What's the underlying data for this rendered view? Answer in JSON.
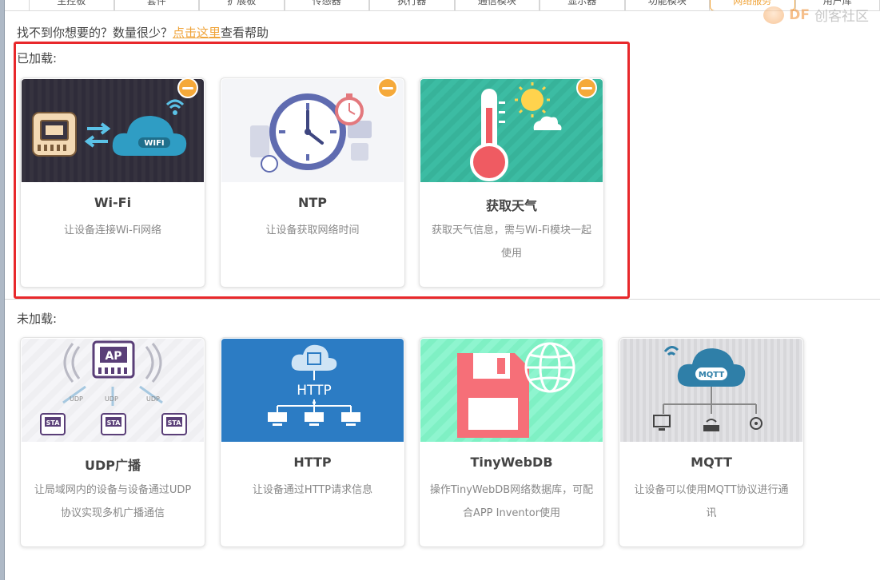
{
  "tabs": [
    "主控板",
    "套件",
    "扩展板",
    "传感器",
    "执行器",
    "通信模块",
    "显示器",
    "功能模块",
    "网络服务",
    "用户库"
  ],
  "active_tab": "网络服务",
  "watermark": {
    "brand": "DF",
    "text": "创客社区"
  },
  "help": {
    "prefix": "找不到你想要的？数量很少？",
    "link": "点击这里",
    "suffix": "查看帮助"
  },
  "loaded": {
    "label": "已加载:",
    "cards": [
      {
        "title": "Wi-Fi",
        "desc": "让设备连接Wi-Fi网络",
        "icon": "wifi-cloud-board-icon"
      },
      {
        "title": "NTP",
        "desc": "让设备获取网络时间",
        "icon": "clock-icon"
      },
      {
        "title": "获取天气",
        "desc": "获取天气信息，需与Wi-Fi模块一起使用",
        "icon": "thermometer-sun-icon"
      }
    ]
  },
  "unloaded": {
    "label": "未加载:",
    "cards": [
      {
        "title": "UDP广播",
        "desc": "让局域网内的设备与设备通过UDP协议实现多机广播通信",
        "icon": "udp-ap-sta-icon",
        "labels": {
          "ap": "AP",
          "sta": "STA",
          "udp": "UDP"
        }
      },
      {
        "title": "HTTP",
        "desc": "让设备通过HTTP请求信息",
        "icon": "http-cloud-icon",
        "labels": {
          "http": "HTTP"
        }
      },
      {
        "title": "TinyWebDB",
        "desc": "操作TinyWebDB网络数据库，可配合APP Inventor使用",
        "icon": "database-globe-icon"
      },
      {
        "title": "MQTT",
        "desc": "让设备可以使用MQTT协议进行通讯",
        "icon": "mqtt-cloud-icon",
        "labels": {
          "mqtt": "MQTT"
        }
      }
    ]
  },
  "colors": {
    "accent": "#f0a43a",
    "highlight": "#e8282b"
  }
}
